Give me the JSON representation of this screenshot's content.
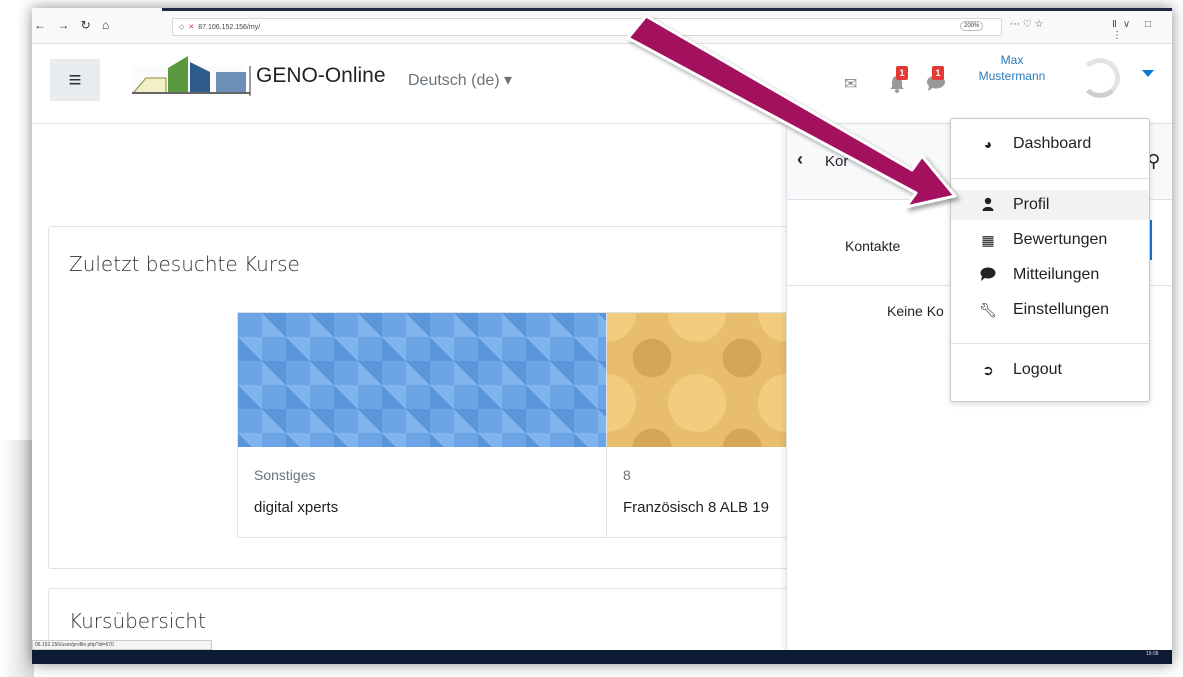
{
  "browser": {
    "url": "87.106.152.156/my/",
    "zoom": "200%",
    "url_actions": "⋯ ♡ ☆",
    "right_icons": "Ⅱ∨ □ ⋮",
    "status_url": "06.152.156/user/profile.php?id=670",
    "clock": "15:08"
  },
  "navbar": {
    "menu_glyph": "≡",
    "site_name": "GENO-Online",
    "language": "Deutsch (de) ▾",
    "notifications_count": "1",
    "messages_count": "1",
    "user_first": "Max",
    "user_last": "Mustermann"
  },
  "recent_courses": {
    "title": "Zuletzt besuchte Kurse",
    "courses": [
      {
        "category": "Sonstiges",
        "name": "digital xperts"
      },
      {
        "category": "8",
        "name": "Französisch 8 ALB 19"
      }
    ]
  },
  "overview": {
    "title": "Kursübersicht"
  },
  "drawer": {
    "title": "Kor",
    "tab": "Kontakte",
    "empty_text": "Keine Ko"
  },
  "user_menu": {
    "items": [
      {
        "label": "Dashboard",
        "icon": "dashboard-icon"
      },
      {
        "label": "Profil",
        "icon": "user-icon"
      },
      {
        "label": "Bewertungen",
        "icon": "table-icon"
      },
      {
        "label": "Mitteilungen",
        "icon": "comment-icon"
      },
      {
        "label": "Einstellungen",
        "icon": "wrench-icon"
      },
      {
        "label": "Logout",
        "icon": "sign-out-icon"
      }
    ]
  },
  "colors": {
    "arrow": "#a3105e",
    "accent": "#1177d1",
    "badge": "#e53935"
  }
}
